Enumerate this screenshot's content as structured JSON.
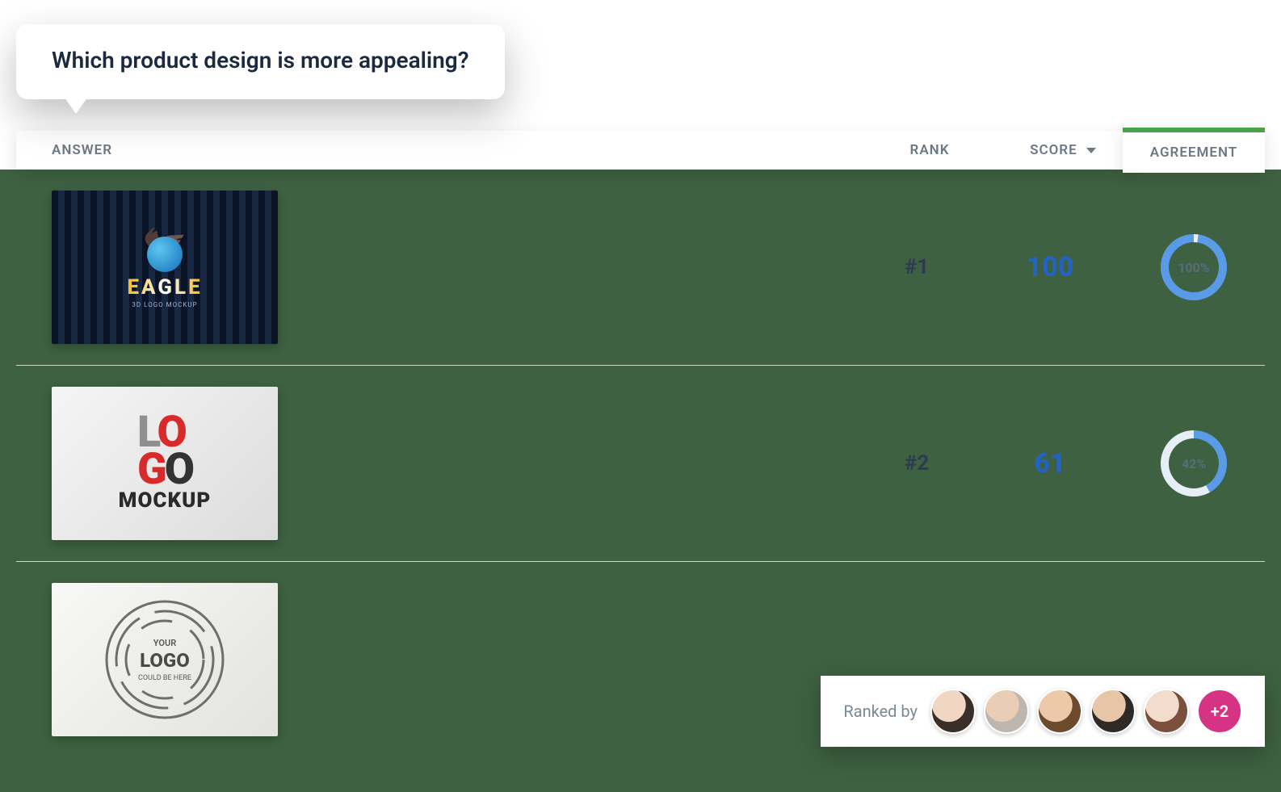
{
  "question": "Which product design is more appealing?",
  "columns": {
    "answer": "ANSWER",
    "rank": "RANK",
    "score": "SCORE",
    "agreement": "AGREEMENT"
  },
  "rows": [
    {
      "thumb_name": "Eagle 3D Logo Mockup",
      "thumb_brand": "EAGLE",
      "thumb_sub": "3D LOGO MOCKUP",
      "rank": "#1",
      "score": "100",
      "agreement_pct": 100,
      "agreement_label": "100%",
      "ring_gradient": "conic-gradient(#e6eef7 0deg 8deg, #5a9be8 8deg 360deg)"
    },
    {
      "thumb_name": "Logo Mockup",
      "thumb_line1": "LOGO",
      "thumb_line2": "MOCKUP",
      "rank": "#2",
      "score": "61",
      "agreement_pct": 42,
      "agreement_label": "42%",
      "ring_gradient": "conic-gradient(#5a9be8 0deg 151deg, #e6eef7 151deg 360deg)"
    },
    {
      "thumb_name": "Your Logo Could Be Here",
      "thumb_top": "YOUR",
      "thumb_mid": "LOGO",
      "thumb_bottom": "COULD BE HERE"
    }
  ],
  "ranked_by": {
    "label": "Ranked by",
    "more": "+2",
    "avatar_count": 5
  },
  "colors": {
    "accent_green": "#4aa24b",
    "score_blue": "#2563c0",
    "ring_fill": "#5a9be8",
    "ring_track": "#e6eef7",
    "more_pink": "#d63384"
  }
}
